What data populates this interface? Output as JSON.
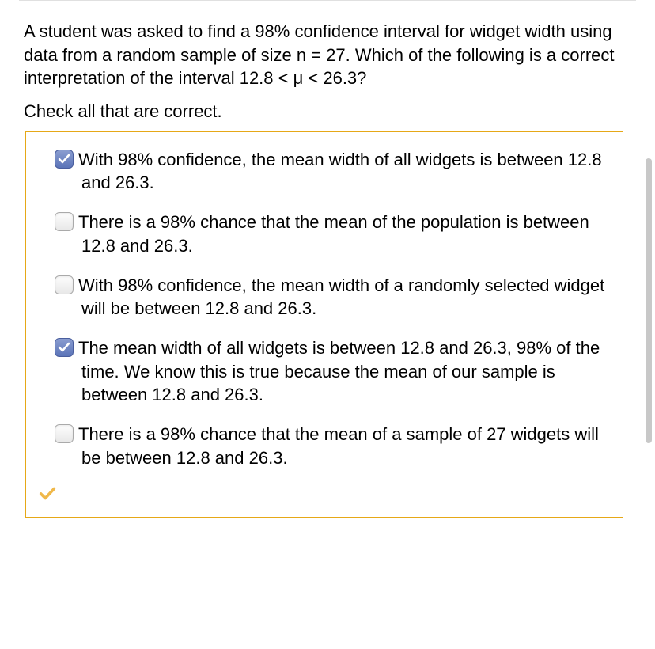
{
  "question": "A student was asked to find a 98% confidence interval for widget width using data from a random sample of size n = 27. Which of the following is a correct interpretation of the interval 12.8 < μ < 26.3?",
  "instruction": "Check all that are correct.",
  "options": [
    {
      "checked": true,
      "text": "With 98% confidence, the mean width of all widgets is between 12.8 and 26.3."
    },
    {
      "checked": false,
      "text": "There is a 98% chance that the mean of the population is between 12.8 and 26.3."
    },
    {
      "checked": false,
      "text": "With 98% confidence, the mean width of a randomly selected widget will be between 12.8 and 26.3."
    },
    {
      "checked": true,
      "text": "The mean width of all widgets is between 12.8 and 26.3, 98% of the time. We know this is true because the mean of our sample is between 12.8 and 26.3."
    },
    {
      "checked": false,
      "text": "There is a 98% chance that the mean of a sample of 27 widgets will be between 12.8 and 26.3."
    }
  ]
}
